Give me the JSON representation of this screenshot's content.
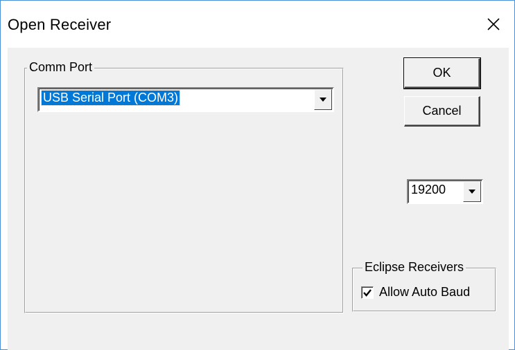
{
  "window": {
    "title": "Open Receiver",
    "close_glyph": "✕"
  },
  "comm_port": {
    "group_label": "Comm Port",
    "selected_port": "USB Serial Port (COM3)"
  },
  "buttons": {
    "ok_label": "OK",
    "cancel_label": "Cancel"
  },
  "baud": {
    "selected_rate": "19200"
  },
  "eclipse": {
    "group_label": "Eclipse Receivers",
    "checkbox_label": "Allow Auto Baud",
    "checked": true
  },
  "icons": {
    "close": "close-icon",
    "dropdown": "chevron-down-icon",
    "check": "checkmark-icon"
  },
  "colors": {
    "selection": "#0078d7",
    "face": "#f0f0f0",
    "window_border": "#4a90d9"
  }
}
